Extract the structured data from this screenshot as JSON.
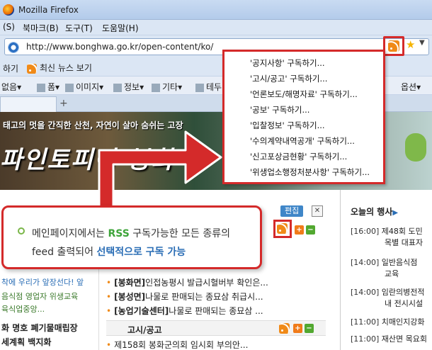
{
  "window": {
    "title": "Mozilla Firefox"
  },
  "menubar": {
    "items": [
      {
        "label": "(S)"
      },
      {
        "label": "북마크(B)"
      },
      {
        "label": "도구(T)"
      },
      {
        "label": "도움말(H)"
      }
    ]
  },
  "urlbar": {
    "url": "http://www.bonghwa.go.kr/open-content/ko/"
  },
  "bookmarks": {
    "item0": "하기",
    "item1": "최신 뉴스 보기"
  },
  "devbar": {
    "items": [
      "없음▾",
      "폼▾",
      "이미지▾",
      "정보▾",
      "기타▾",
      "테두"
    ],
    "right": "옵션▾"
  },
  "feed_menu": {
    "items": [
      "'공지사항' 구독하기...",
      "'고시/공고' 구독하기...",
      "'언론보도/해명자료' 구독하기...",
      "'공보' 구독하기...",
      "'입찰정보' 구독하기...",
      "'수의계약내역공개' 구독하기...",
      "'신고포상금현황' 구독하기...",
      "'위생업소행정처분사항' 구독하기..."
    ]
  },
  "banner": {
    "slogan": "태고의 멋을 간직한 산천, 자연이 살아 숨쉬는 고장",
    "big_text": "파인토피아 봉화"
  },
  "callout": {
    "line1_prefix": "메인페이지에서는 ",
    "line1_highlight": "RSS",
    "line1_suffix": " 구독가능한 모든 종류의",
    "line2_prefix": "feed 출력되어 ",
    "line2_highlight": "선택적으로 구독 가능"
  },
  "left_col": {
    "lines": [
      "착에 우리가 앞장선다! 앞",
      "음식점 영업자 위생교육",
      "육식업중앙...",
      "화 명호 폐기물매립장",
      "세계획 백지화"
    ]
  },
  "mid_col": {
    "edit_label": "편집",
    "close_label": "✕",
    "plus": "+",
    "minus": "−",
    "rows": [
      {
        "src": "[봉화면]",
        "text": "인접농평시 발급시혈버부 확인은..."
      },
      {
        "src": "[봉성면]",
        "text": "나물로 판매되는 종묘삼 취급시..."
      },
      {
        "src": "[농업기술센터]",
        "text": "나물로 판매되는 종묘삼 ..."
      }
    ],
    "section_title": "고시/공고",
    "last_row": "제158회 봉화군의회 임시회 부의안..."
  },
  "right_col": {
    "title": "오늘의 행사",
    "arrow": "▶",
    "events": [
      {
        "time": "[16:00]",
        "text": "제48회 도민"
      },
      {
        "time": "",
        "text": "목별 대표자"
      },
      {
        "time": "[14:00]",
        "text": "일반음식점"
      },
      {
        "time": "",
        "text": "교육"
      },
      {
        "time": "[14:00]",
        "text": "임란의병전적"
      },
      {
        "time": "",
        "text": "내 전시시설"
      },
      {
        "time": "[11:00]",
        "text": "치매인지강화"
      },
      {
        "time": "[11:00]",
        "text": "재산면 목요회"
      }
    ]
  },
  "colors": {
    "highlight_red": "#d42a2a",
    "rss_orange": "#f08a18",
    "accent_green": "#3ea43a",
    "accent_blue": "#2a6db5"
  }
}
